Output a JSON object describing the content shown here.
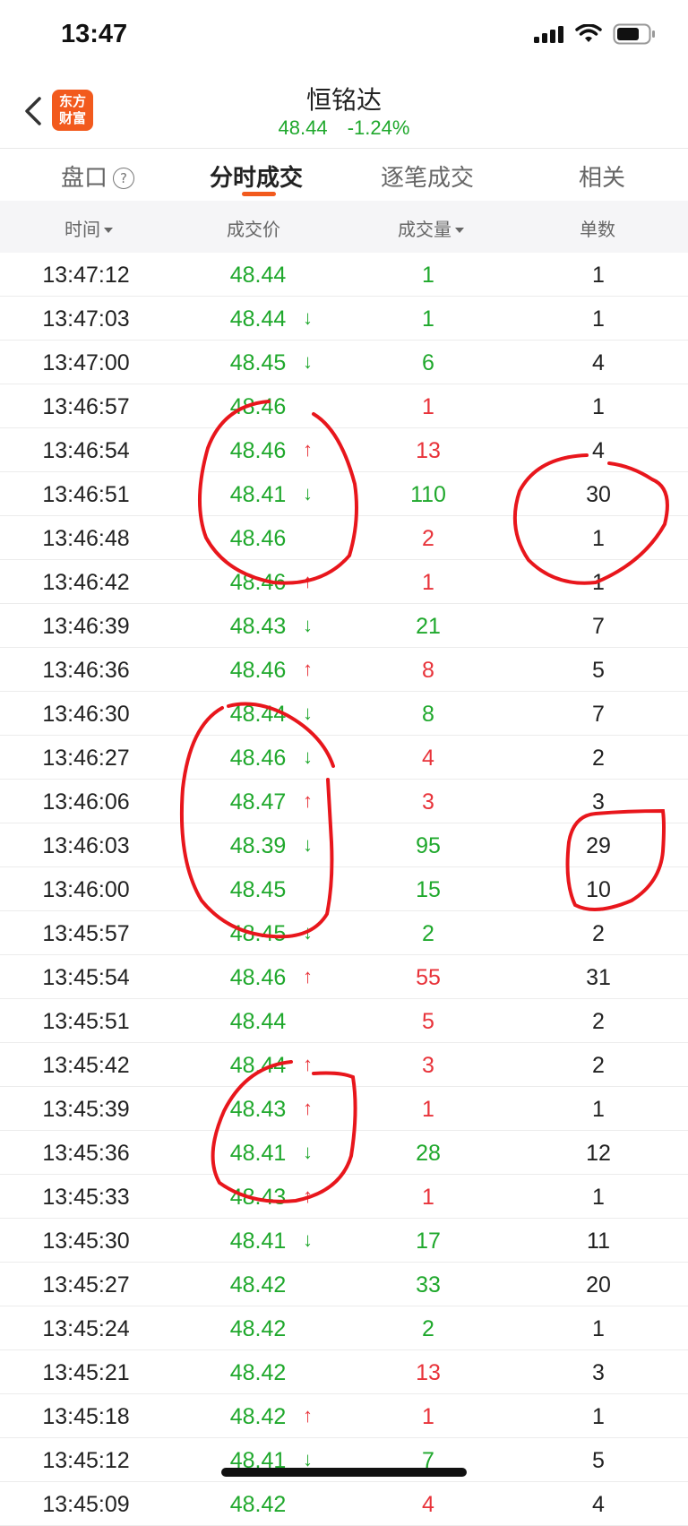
{
  "status": {
    "time": "13:47"
  },
  "nav": {
    "logo_line1": "东方",
    "logo_line2": "财富",
    "title": "恒铭达",
    "price": "48.44",
    "change": "-1.24%"
  },
  "tabs": [
    {
      "label": "盘口"
    },
    {
      "label": "分时成交"
    },
    {
      "label": "逐笔成交"
    },
    {
      "label": "相关"
    }
  ],
  "columns": {
    "time": "时间",
    "price": "成交价",
    "volume": "成交量",
    "count": "单数"
  },
  "colors": {
    "up": "#e8333a",
    "down": "#1fa82c",
    "accent": "#f25a1d",
    "annotation": "#e8161c"
  },
  "rows": [
    {
      "time": "13:47:12",
      "price": "48.44",
      "arrow": "",
      "volume": "1",
      "vol_color": "down",
      "count": "1"
    },
    {
      "time": "13:47:03",
      "price": "48.44",
      "arrow": "↓",
      "volume": "1",
      "vol_color": "down",
      "count": "1"
    },
    {
      "time": "13:47:00",
      "price": "48.45",
      "arrow": "↓",
      "volume": "6",
      "vol_color": "down",
      "count": "4"
    },
    {
      "time": "13:46:57",
      "price": "48.46",
      "arrow": "",
      "volume": "1",
      "vol_color": "up",
      "count": "1"
    },
    {
      "time": "13:46:54",
      "price": "48.46",
      "arrow": "↑",
      "volume": "13",
      "vol_color": "up",
      "count": "4"
    },
    {
      "time": "13:46:51",
      "price": "48.41",
      "arrow": "↓",
      "volume": "110",
      "vol_color": "down",
      "count": "30"
    },
    {
      "time": "13:46:48",
      "price": "48.46",
      "arrow": "",
      "volume": "2",
      "vol_color": "up",
      "count": "1"
    },
    {
      "time": "13:46:42",
      "price": "48.46",
      "arrow": "↑",
      "volume": "1",
      "vol_color": "up",
      "count": "1"
    },
    {
      "time": "13:46:39",
      "price": "48.43",
      "arrow": "↓",
      "volume": "21",
      "vol_color": "down",
      "count": "7"
    },
    {
      "time": "13:46:36",
      "price": "48.46",
      "arrow": "↑",
      "volume": "8",
      "vol_color": "up",
      "count": "5"
    },
    {
      "time": "13:46:30",
      "price": "48.44",
      "arrow": "↓",
      "volume": "8",
      "vol_color": "down",
      "count": "7"
    },
    {
      "time": "13:46:27",
      "price": "48.46",
      "arrow": "↓",
      "volume": "4",
      "vol_color": "up",
      "count": "2"
    },
    {
      "time": "13:46:06",
      "price": "48.47",
      "arrow": "↑",
      "volume": "3",
      "vol_color": "up",
      "count": "3"
    },
    {
      "time": "13:46:03",
      "price": "48.39",
      "arrow": "↓",
      "volume": "95",
      "vol_color": "down",
      "count": "29"
    },
    {
      "time": "13:46:00",
      "price": "48.45",
      "arrow": "",
      "volume": "15",
      "vol_color": "down",
      "count": "10"
    },
    {
      "time": "13:45:57",
      "price": "48.45",
      "arrow": "↓",
      "volume": "2",
      "vol_color": "down",
      "count": "2"
    },
    {
      "time": "13:45:54",
      "price": "48.46",
      "arrow": "↑",
      "volume": "55",
      "vol_color": "up",
      "count": "31"
    },
    {
      "time": "13:45:51",
      "price": "48.44",
      "arrow": "",
      "volume": "5",
      "vol_color": "up",
      "count": "2"
    },
    {
      "time": "13:45:42",
      "price": "48.44",
      "arrow": "↑",
      "volume": "3",
      "vol_color": "up",
      "count": "2"
    },
    {
      "time": "13:45:39",
      "price": "48.43",
      "arrow": "↑",
      "volume": "1",
      "vol_color": "up",
      "count": "1"
    },
    {
      "time": "13:45:36",
      "price": "48.41",
      "arrow": "↓",
      "volume": "28",
      "vol_color": "down",
      "count": "12"
    },
    {
      "time": "13:45:33",
      "price": "48.43",
      "arrow": "↑",
      "volume": "1",
      "vol_color": "up",
      "count": "1"
    },
    {
      "time": "13:45:30",
      "price": "48.41",
      "arrow": "↓",
      "volume": "17",
      "vol_color": "down",
      "count": "11"
    },
    {
      "time": "13:45:27",
      "price": "48.42",
      "arrow": "",
      "volume": "33",
      "vol_color": "down",
      "count": "20"
    },
    {
      "time": "13:45:24",
      "price": "48.42",
      "arrow": "",
      "volume": "2",
      "vol_color": "down",
      "count": "1"
    },
    {
      "time": "13:45:21",
      "price": "48.42",
      "arrow": "",
      "volume": "13",
      "vol_color": "up",
      "count": "3"
    },
    {
      "time": "13:45:18",
      "price": "48.42",
      "arrow": "↑",
      "volume": "1",
      "vol_color": "up",
      "count": "1"
    },
    {
      "time": "13:45:12",
      "price": "48.41",
      "arrow": "↓",
      "volume": "7",
      "vol_color": "down",
      "count": "5"
    },
    {
      "time": "13:45:09",
      "price": "48.42",
      "arrow": "",
      "volume": "4",
      "vol_color": "up",
      "count": "4"
    }
  ]
}
